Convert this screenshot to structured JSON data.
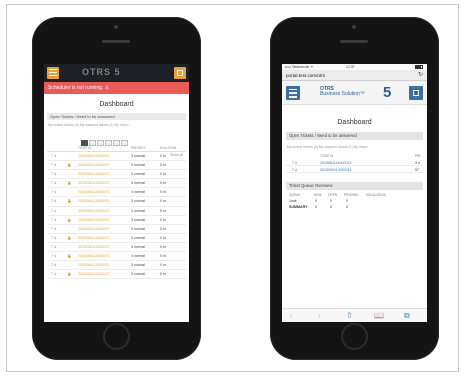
{
  "left_phone": {
    "notice": "Scheduler is not running. ⚠",
    "logo": "OTRS 5",
    "title": "Dashboard",
    "section": "Open Tickets / Need to be answered",
    "subtabs": "My locked tickets (0)   My watched tickets (1)   My respo",
    "pages": [
      "1",
      "2",
      "3",
      "4",
      "5",
      "6"
    ],
    "show_all": "Show all",
    "columns": [
      "",
      "",
      "TICKET#",
      "PRIORITY",
      "SOLUTION"
    ],
    "rows": [
      {
        "age": "7 d",
        "lock": "",
        "number": "2015060114000471",
        "priority": "3 normal",
        "state": "0 m"
      },
      {
        "age": "7 d",
        "lock": "🔒",
        "number": "2015060114000471",
        "priority": "3 normal",
        "state": "0 m"
      },
      {
        "age": "7 d",
        "lock": "",
        "number": "2015060114000471",
        "priority": "3 normal",
        "state": "0 m"
      },
      {
        "age": "7 d",
        "lock": "🔒",
        "number": "2015060114000471",
        "priority": "3 normal",
        "state": "0 m"
      },
      {
        "age": "7 d",
        "lock": "",
        "number": "2015060114000471",
        "priority": "3 normal",
        "state": "0 m"
      },
      {
        "age": "7 d",
        "lock": "🔒",
        "number": "2015060114000471",
        "priority": "3 normal",
        "state": "0 m"
      },
      {
        "age": "7 d",
        "lock": "",
        "number": "2015060114000471",
        "priority": "3 normal",
        "state": "0 m"
      },
      {
        "age": "7 d",
        "lock": "🔒",
        "number": "2015060114000471",
        "priority": "3 normal",
        "state": "0 m"
      },
      {
        "age": "7 d",
        "lock": "",
        "number": "2015060114000471",
        "priority": "3 normal",
        "state": "0 m"
      },
      {
        "age": "7 d",
        "lock": "🔒",
        "number": "2015060114000471",
        "priority": "3 normal",
        "state": "0 m"
      },
      {
        "age": "7 d",
        "lock": "",
        "number": "2015060114000471",
        "priority": "3 normal",
        "state": "0 m"
      },
      {
        "age": "7 d",
        "lock": "🔒",
        "number": "2015060114000471",
        "priority": "3 normal",
        "state": "0 m"
      },
      {
        "age": "7 d",
        "lock": "",
        "number": "2015060114000471",
        "priority": "3 normal",
        "state": "0 m"
      },
      {
        "age": "7 d",
        "lock": "🔒",
        "number": "2015060114000471",
        "priority": "3 normal",
        "state": "0 m"
      }
    ]
  },
  "right_phone": {
    "carrier": "••••• Telekom.de ᯤ",
    "time": "12:37",
    "url": "portal.test.com/otrs",
    "reload": "↻",
    "logo_line1": "OTRS",
    "logo_line2": "Business Solution™",
    "logo_number": "5",
    "title": "Dashboard",
    "section": "Open Tickets / Need to be answered",
    "subtabs": "My locked tickets (0)   My watched tickets (1)   My respo",
    "columns": [
      "",
      "TICKET#",
      "PRI"
    ],
    "rows": [
      {
        "age": "7 d",
        "number": "2015061114000014",
        "priority": "3 n"
      },
      {
        "age": "7 d",
        "number": "2015060114000011",
        "priority": "97"
      }
    ],
    "queue_section": "Ticket Queue Overview",
    "queue_columns": [
      "QUEUE",
      "NEW",
      "OPEN",
      "PENDING",
      "ESCALATION"
    ],
    "queue_rows": [
      {
        "name": "Junk",
        "new": "0",
        "open": "0",
        "pending": "0"
      },
      {
        "name": "SUMMARY",
        "new": "0",
        "open": "0",
        "pending": "0"
      }
    ],
    "toolbar": [
      "‹",
      "›",
      "⇧",
      "📖",
      "⧉"
    ]
  }
}
